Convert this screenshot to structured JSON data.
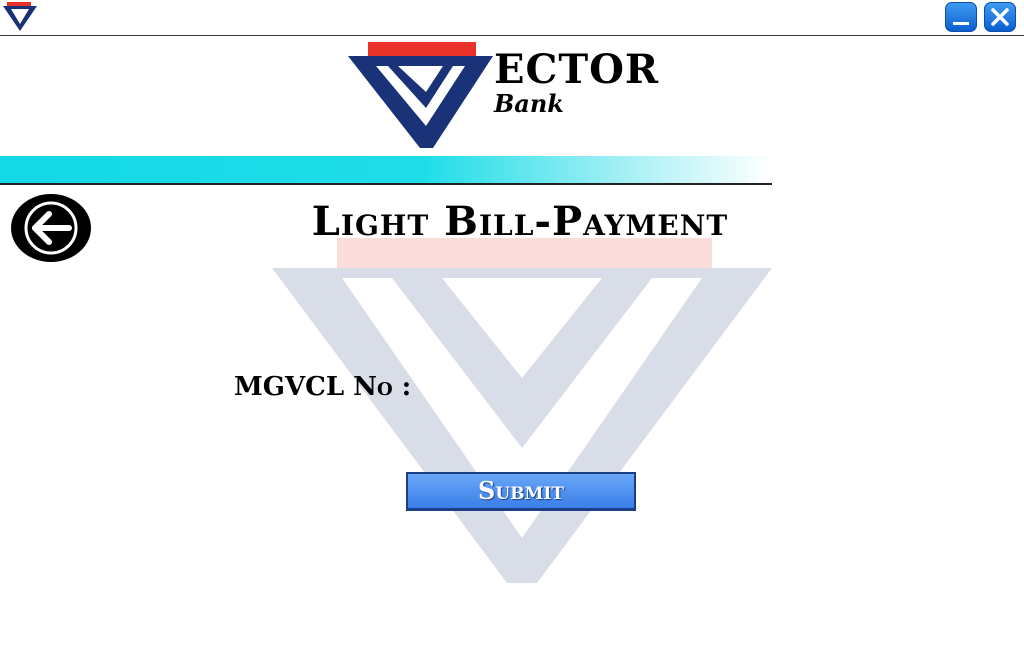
{
  "window": {
    "minimize_icon": "minimize-icon",
    "close_icon": "close-icon",
    "app_icon": "vector-logo-icon"
  },
  "logo": {
    "word": "ECTOR",
    "sub": "Bank",
    "colors": {
      "red": "#e8322a",
      "navy": "#1a3278"
    }
  },
  "back": {
    "icon": "arrow-left-icon"
  },
  "page": {
    "title": "Light Bill-Payment"
  },
  "form": {
    "label": "MGVCL No :",
    "input_value": "",
    "submit_label": "Submit"
  },
  "colors": {
    "accent_cyan": "#13d8e6",
    "button_blue": "#4a8af0"
  }
}
